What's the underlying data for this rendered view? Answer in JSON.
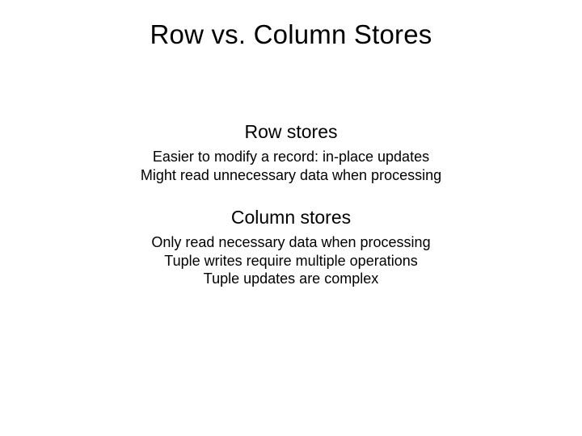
{
  "title": "Row vs. Column Stores",
  "row": {
    "heading": "Row stores",
    "lines": [
      "Easier to modify a record: in-place updates",
      "Might read unnecessary data when processing"
    ]
  },
  "column": {
    "heading": "Column stores",
    "lines": [
      "Only read necessary data when processing",
      "Tuple writes require multiple operations",
      "Tuple updates are complex"
    ]
  }
}
